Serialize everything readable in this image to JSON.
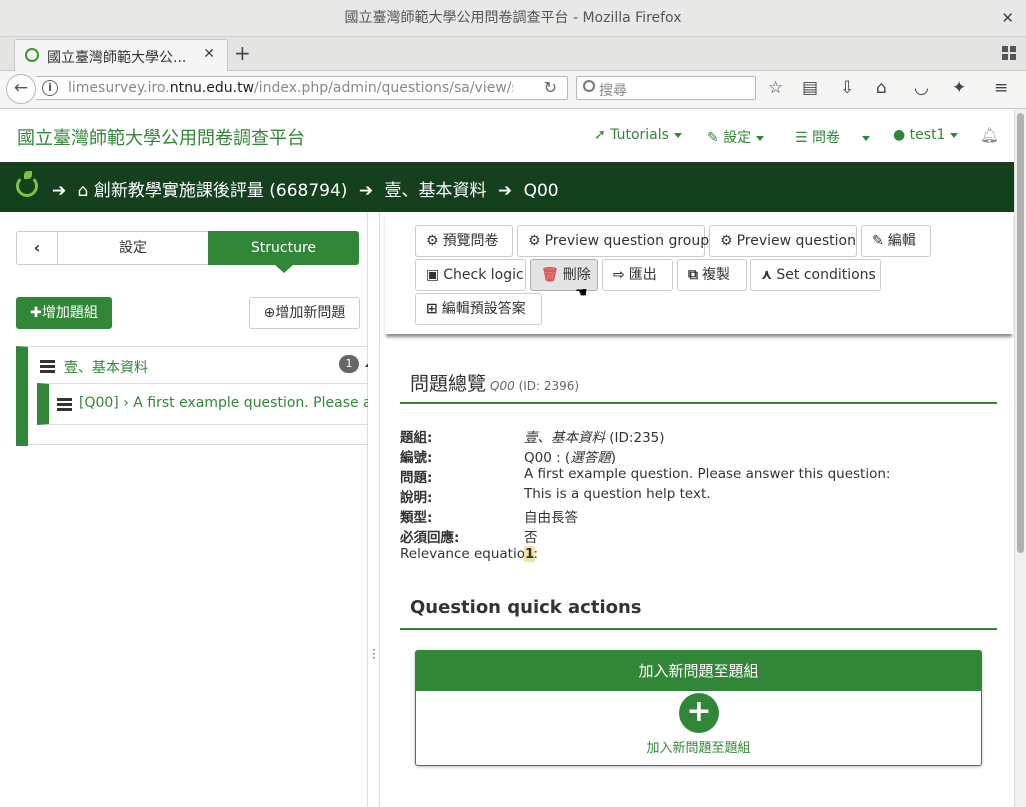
{
  "browser": {
    "window_title": "國立臺灣師範大學公用問卷調查平台 - Mozilla Firefox",
    "tab_title": "國立臺灣師範大學公...",
    "url_prefix": "limesurvey.iro.",
    "url_domain": "ntnu.edu.tw",
    "url_rest": "/index.php/admin/questions/sa/view/surve",
    "search_placeholder": "搜尋"
  },
  "header": {
    "brand": "國立臺灣師範大學公用問卷調查平台",
    "menu": [
      {
        "icon": "rocket-icon",
        "label": "Tutorials"
      },
      {
        "icon": "wrench-icon",
        "label": "設定"
      },
      {
        "icon": "list-icon",
        "label": "問卷"
      },
      {
        "icon": "user-icon",
        "label": "test1"
      }
    ]
  },
  "breadcrumb": {
    "survey": "創新教學實施課後評量 (668794)",
    "group": "壹、基本資料",
    "question": "Q00"
  },
  "sidebar": {
    "settings_tab": "設定",
    "structure_tab": "Structure",
    "add_group_button": "增加題組",
    "add_question_button": "增加新問題",
    "group": {
      "label": "壹、基本資料",
      "count": "1"
    },
    "question": {
      "label": "[Q00] › A first example question. Please an..."
    }
  },
  "toolbar": {
    "preview_survey": "預覽問卷",
    "preview_group": "Preview question group",
    "preview_question": "Preview question",
    "edit": "編輯",
    "check_logic": "Check logic",
    "delete": "刪除",
    "export": "匯出",
    "copy": "複製",
    "set_conditions": "Set conditions",
    "edit_default_answers": "編輯預設答案"
  },
  "overview": {
    "title": "問題總覽",
    "code": "Q00",
    "id_text": "(ID: 2396)",
    "rows": [
      {
        "key": "題組:",
        "value_italic": "壹、基本資料",
        "value": " (ID:235)"
      },
      {
        "key": "編號:",
        "value": "Q00 : (",
        "value_italic": "選答題",
        "value_after": ")"
      },
      {
        "key": "問題:",
        "value": "A first example question. Please answer this question:"
      },
      {
        "key": "說明:",
        "value": "This is a question help text."
      },
      {
        "key": "類型:",
        "value": "自由長答"
      },
      {
        "key": "必須回應:",
        "value": "否"
      },
      {
        "key": "Relevance equation:",
        "value": "1"
      }
    ]
  },
  "quick_actions": {
    "title": "Question quick actions",
    "panel_heading": "加入新問題至題組",
    "panel_label": "加入新問題至題組"
  },
  "colors": {
    "brand_green": "#328637",
    "dark_green": "#15401e"
  }
}
